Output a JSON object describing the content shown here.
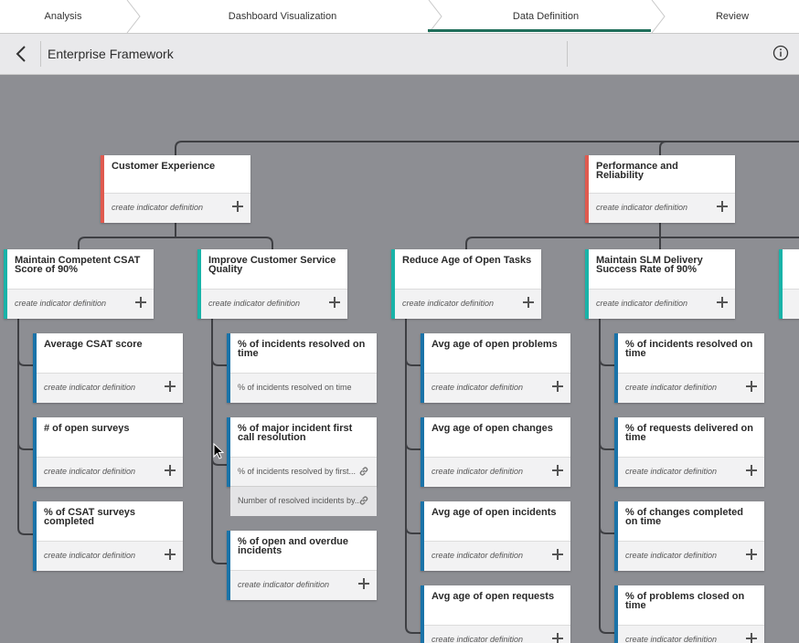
{
  "tabs": [
    {
      "label": "Analysis"
    },
    {
      "label": "Dashboard Visualization"
    },
    {
      "label": "Data Definition"
    },
    {
      "label": "Review"
    }
  ],
  "header": {
    "title": "Enterprise Framework"
  },
  "icons": {
    "back": "chevron-left-icon",
    "info": "info-icon",
    "plus": "plus-icon",
    "link": "link-icon"
  },
  "colors": {
    "objective": "#e05a4f",
    "goal": "#19b3a8",
    "indicator": "#1a73a8",
    "active_tab": "#1f6e5a"
  },
  "create_label": "create indicator definition",
  "objectives": [
    {
      "title": "Customer Experience",
      "footer": "create indicator definition"
    },
    {
      "title": "Performance and Reliability",
      "footer": "create indicator definition"
    }
  ],
  "goals": [
    {
      "title": "Maintain Competent CSAT Score of 90%",
      "footer": "create indicator definition"
    },
    {
      "title": "Improve Customer Service Quality",
      "footer": "create indicator definition"
    },
    {
      "title": "Reduce Age of Open Tasks",
      "footer": "create indicator definition"
    },
    {
      "title": "Maintain SLM Delivery Success Rate of 90%",
      "footer": "create indicator definition"
    }
  ],
  "indicators": {
    "col1": [
      {
        "title": "Average CSAT score",
        "footer": "create indicator definition"
      },
      {
        "title": "# of open surveys",
        "footer": "create indicator definition"
      },
      {
        "title": "% of CSAT surveys completed",
        "footer": "create indicator definition"
      }
    ],
    "col2": [
      {
        "title": "% of incidents resolved on time",
        "footer": "% of incidents resolved on time"
      },
      {
        "title": "% of major incident first call resolution",
        "footer": "% of incidents resolved by first...",
        "footer2": "Number of resolved incidents by..."
      },
      {
        "title": "% of open and overdue incidents",
        "footer": "create indicator definition"
      }
    ],
    "col3": [
      {
        "title": "Avg age of open problems",
        "footer": "create indicator definition"
      },
      {
        "title": "Avg age of open changes",
        "footer": "create indicator definition"
      },
      {
        "title": "Avg age of open incidents",
        "footer": "create indicator definition"
      },
      {
        "title": "Avg age of open requests",
        "footer": "create indicator definition"
      }
    ],
    "col4": [
      {
        "title": "% of incidents resolved on time",
        "footer": "create indicator definition"
      },
      {
        "title": "% of requests delivered on time",
        "footer": "create indicator definition"
      },
      {
        "title": "% of changes completed on time",
        "footer": "create indicator definition"
      },
      {
        "title": "% of problems closed on time",
        "footer": "create indicator definition"
      }
    ]
  }
}
